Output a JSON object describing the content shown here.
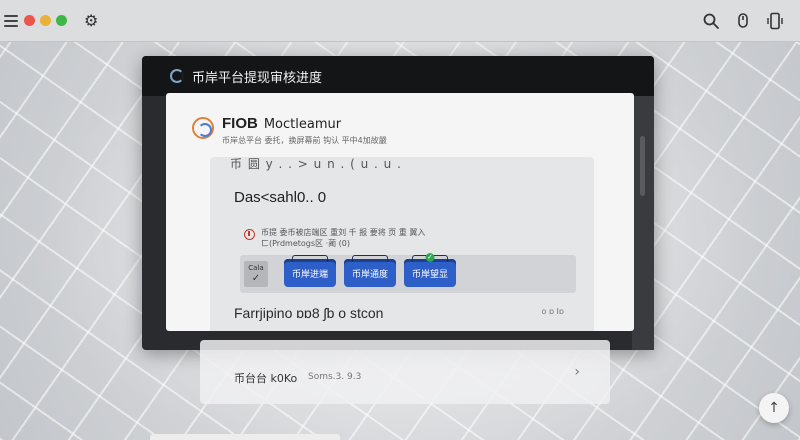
{
  "window": {
    "traffic_colors": [
      "#e8574a",
      "#e8b13a",
      "#3fb54a"
    ]
  },
  "card": {
    "header_title": "币岸平台提现审核进度"
  },
  "brand": {
    "name": "FIOB",
    "tagline": "Moctleamur",
    "subtitle": "币岸总平台 委托，换屏幕前 钩认 平中4加故嚴",
    "cut_text": "币 圆 y . . > u  n . (  u . u ."
  },
  "panel": {
    "title": "Das<sahl0.. 0",
    "info_line1": "币提 委币被店端区 重刘 千 报 要将 页 重 翼入",
    "info_line2": "ㄈ(Prdmetogs区 ·蔺 (0)",
    "step_lead_label": "Cala",
    "step_lead_mark": "✓",
    "steps": [
      {
        "label": "币岸进端"
      },
      {
        "label": "币岸通度"
      },
      {
        "label": "币岸望显",
        "badge": "✓"
      }
    ],
    "bottom_title": "Farrjipino ɒɒ8 ʃb o stcon",
    "bottom_meta": "o ɒ Iɒ"
  },
  "ghost_item": {
    "label": "币台台 k0Ko",
    "meta": "Soms.3.   9.3",
    "chevron": "›"
  },
  "fab": {
    "icon": "↑"
  }
}
